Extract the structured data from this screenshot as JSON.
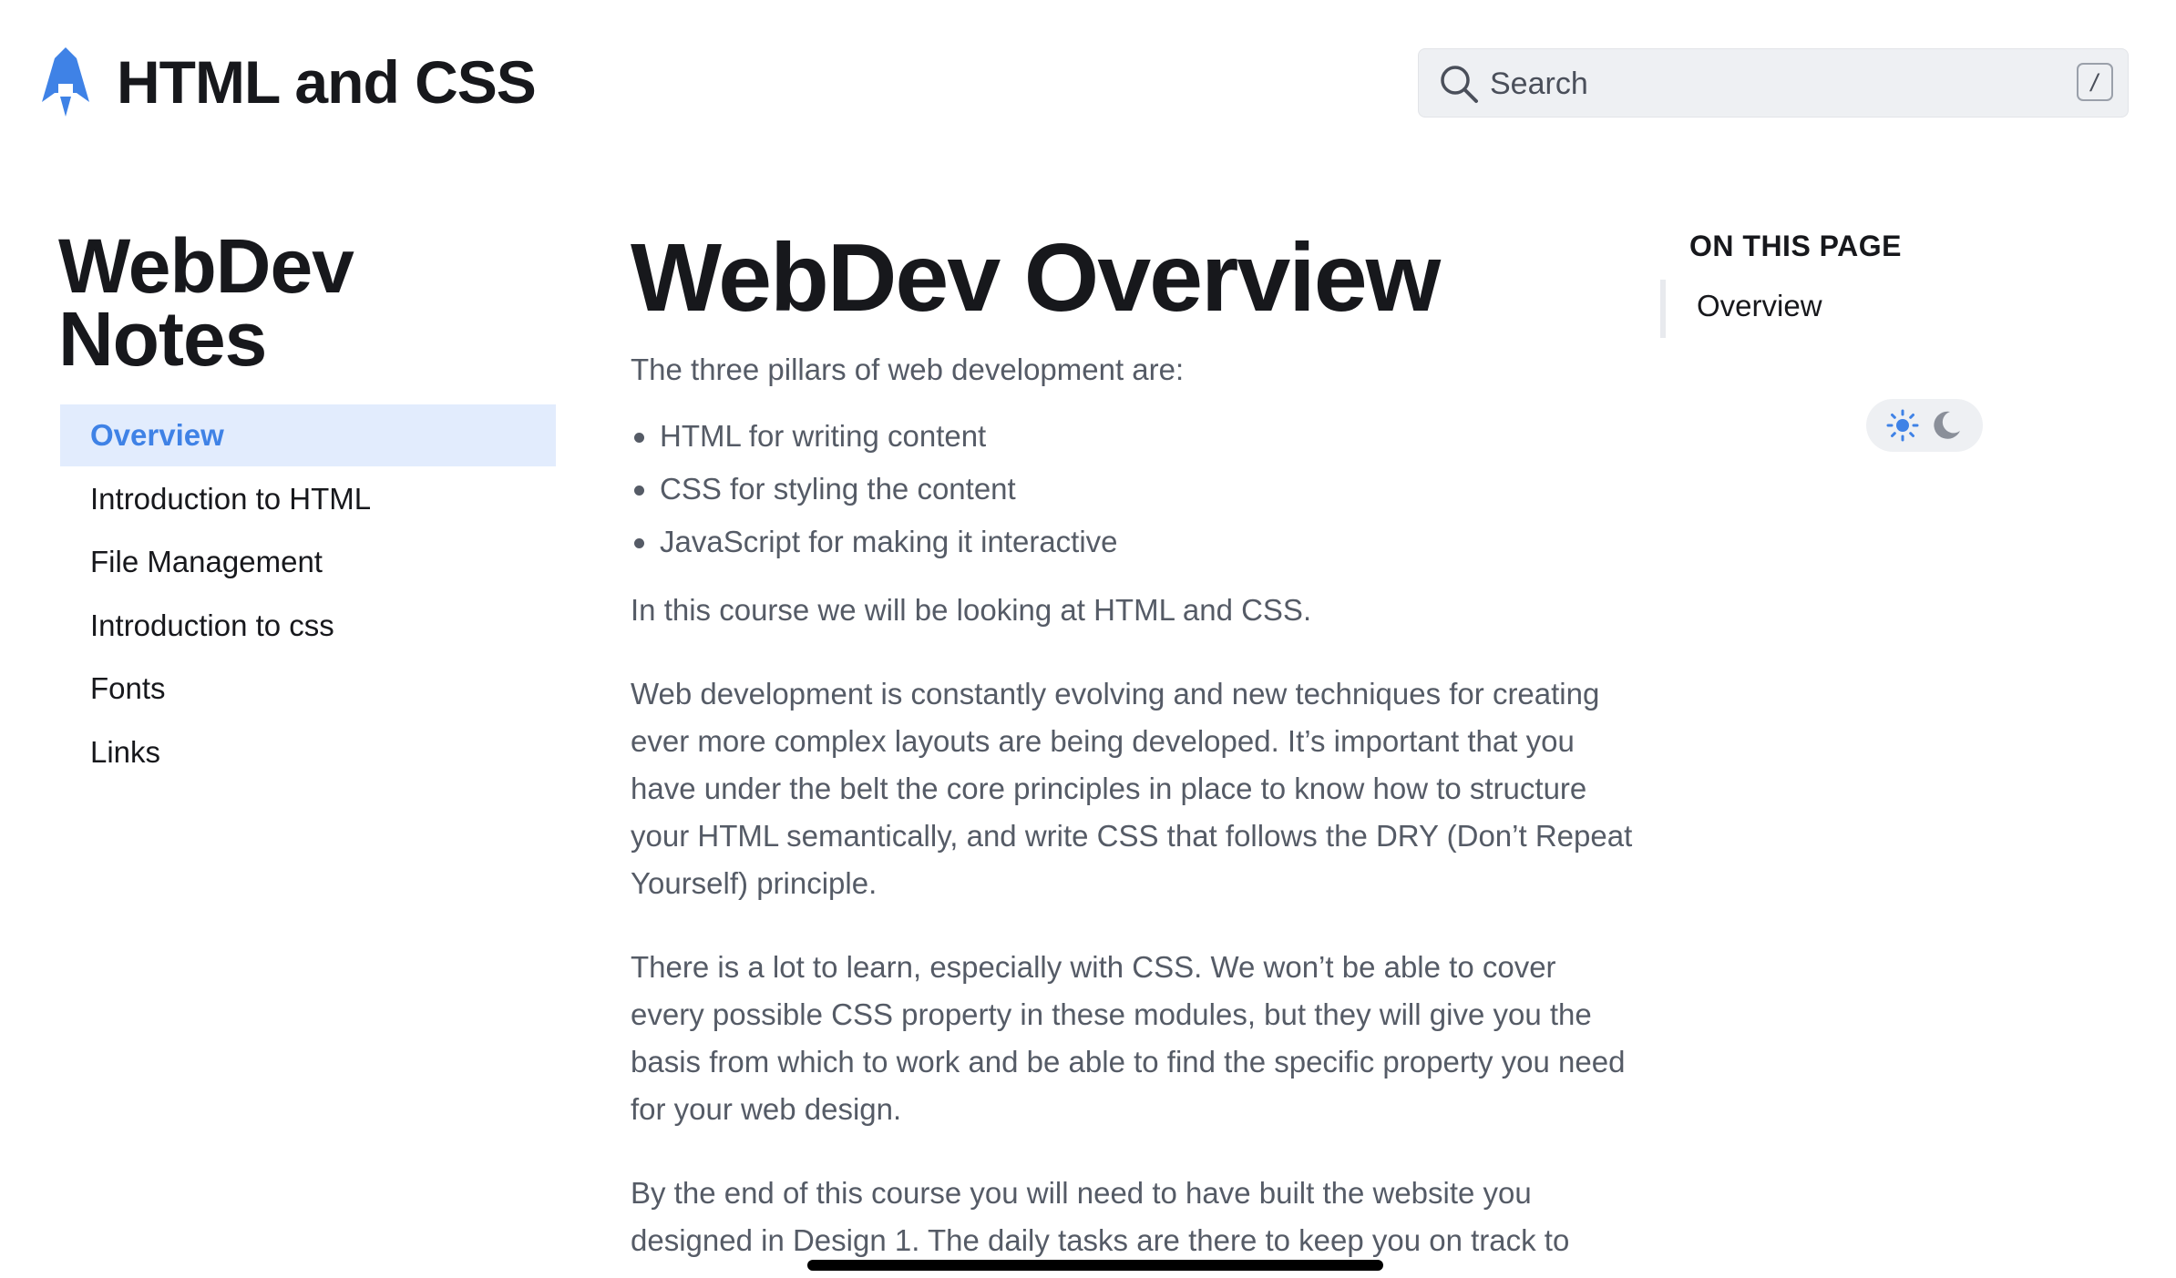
{
  "header": {
    "site_title": "HTML and CSS",
    "logo_icon": "rocket-icon",
    "search": {
      "placeholder": "Search",
      "icon": "search-icon",
      "shortcut": "/"
    }
  },
  "sidebar": {
    "title": "WebDev Notes",
    "items": [
      {
        "label": "Overview",
        "active": true
      },
      {
        "label": "Introduction to HTML",
        "active": false
      },
      {
        "label": "File Management",
        "active": false
      },
      {
        "label": "Introduction to css",
        "active": false
      },
      {
        "label": "Fonts",
        "active": false
      },
      {
        "label": "Links",
        "active": false
      }
    ]
  },
  "main": {
    "title": "WebDev Overview",
    "intro": "The three pillars of web development are:",
    "bullets": [
      "HTML for writing content",
      "CSS for styling the content",
      "JavaScript for making it interactive"
    ],
    "paragraphs": [
      "In this course we will be looking at HTML and CSS.",
      "Web development is constantly evolving and new techniques for creating ever more complex layouts are being developed. It’s important that you have under the belt the core principles in place to know how to structure your HTML semantically, and write CSS that follows the DRY (Don’t Repeat Yourself) principle.",
      "There is a lot to learn, especially with CSS. We won’t be able to cover every possible CSS property in these modules, but they will give you the basis from which to work and be able to find the specific property you need for your web design.",
      "By the end of this course you will need to have built the website you designed in Design 1. The daily tasks are there to keep you on track to"
    ]
  },
  "toc": {
    "heading": "ON THIS PAGE",
    "links": [
      "Overview"
    ]
  },
  "theme_toggle": {
    "icons": [
      "sun-icon",
      "moon-icon"
    ],
    "active": "light"
  },
  "colors": {
    "accent": "#3f82e6",
    "active_bg": "#e2ecfd",
    "text": "#17181c",
    "muted_text": "#555b66",
    "search_bg": "#eef0f3"
  }
}
